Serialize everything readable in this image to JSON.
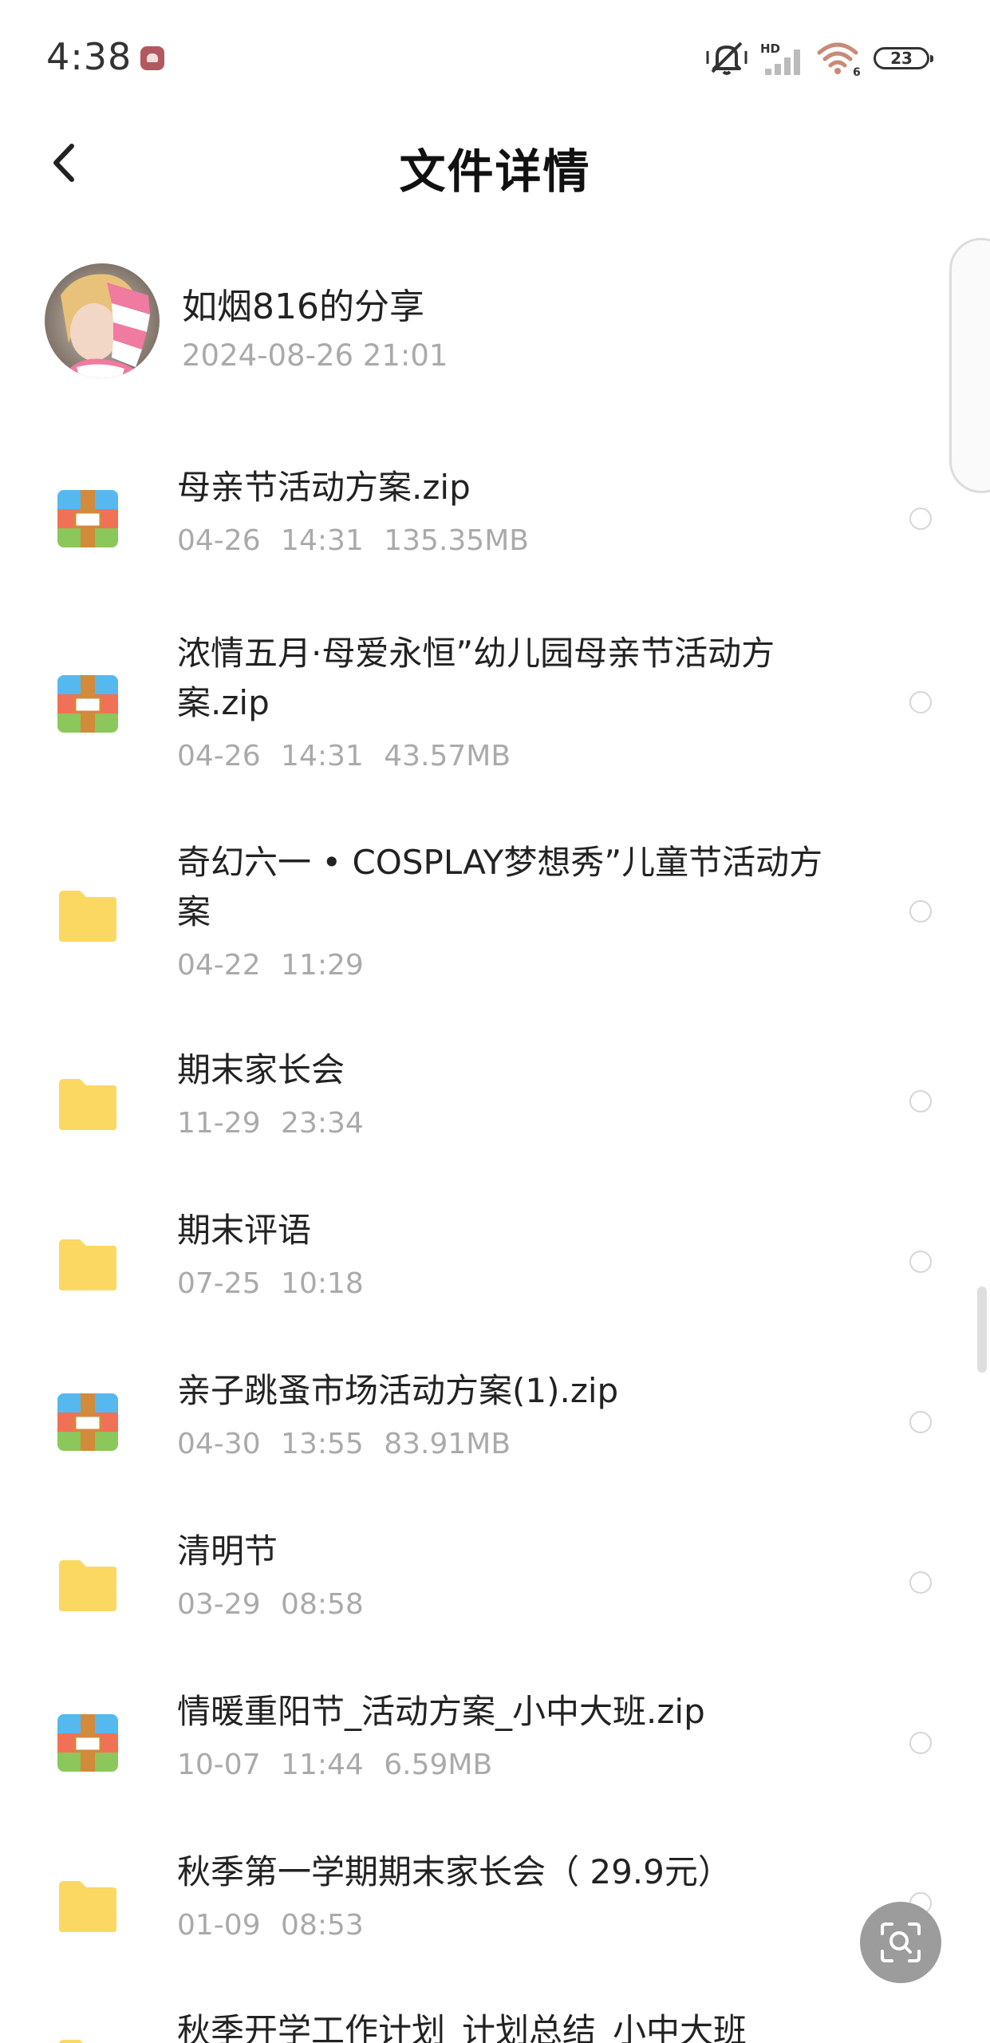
{
  "status_bar": {
    "time": "4:38",
    "network_label": "HD",
    "wifi_label": "6",
    "battery": "23",
    "icons": [
      "app-notification-icon",
      "mute-icon",
      "signal-icon",
      "wifi-icon",
      "battery-icon"
    ]
  },
  "header": {
    "title": "文件详情",
    "back_icon": "chevron-left-icon"
  },
  "share": {
    "name": "如烟816的分享",
    "time": "2024-08-26  21:01"
  },
  "files": [
    {
      "type": "zip",
      "name": "母亲节活动方案.zip",
      "meta": "04-26 14:31 135.35MB"
    },
    {
      "type": "zip",
      "name": "浓情五月·母爱永恒”幼儿园母亲节活动方案.zip",
      "meta": "04-26 14:31 43.57MB"
    },
    {
      "type": "folder",
      "name": "奇幻六一 • COSPLAY梦想秀”儿童节活动方案",
      "meta": "04-22 11:29"
    },
    {
      "type": "folder",
      "name": "期末家长会",
      "meta": "11-29 23:34"
    },
    {
      "type": "folder",
      "name": "期末评语",
      "meta": "07-25 10:18"
    },
    {
      "type": "zip",
      "name": "亲子跳蚤市场活动方案(1).zip",
      "meta": "04-30 13:55 83.91MB"
    },
    {
      "type": "folder",
      "name": "清明节",
      "meta": "03-29 08:58"
    },
    {
      "type": "zip",
      "name": "情暖重阳节_活动方案_小中大班.zip",
      "meta": "10-07 11:44 6.59MB"
    },
    {
      "type": "folder",
      "name": "秋季第一学期期末家长会（ 29.9元）",
      "meta": "01-09 08:53"
    },
    {
      "type": "folder",
      "name": "秋季开学工作计划_计划总结_小中大班",
      "meta": ""
    }
  ],
  "colors": {
    "folder": "#fbd862",
    "zip_top": "#55b9ef",
    "zip_middle": "#f07156",
    "zip_bottom": "#8bc75a",
    "zip_clasp": "#d28a3b",
    "meta_text": "#aaaaaa"
  },
  "floating_button": {
    "icon": "scan-search-icon"
  }
}
